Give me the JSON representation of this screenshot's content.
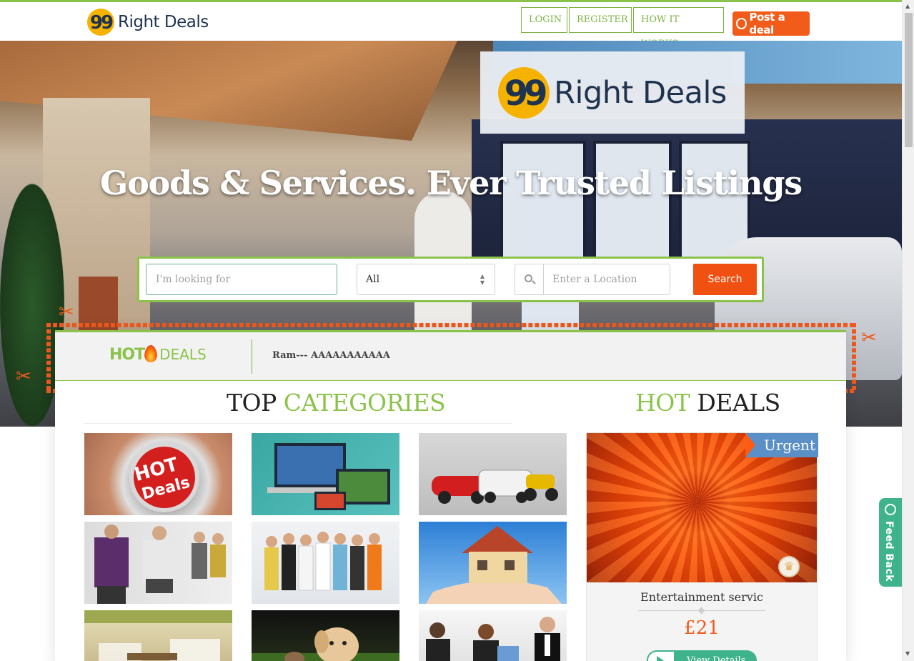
{
  "brand": {
    "name": "Right Deals",
    "mark": "99"
  },
  "nav": {
    "login": "LOGIN",
    "register": "REGISTER",
    "how_it_works": "HOW IT WORKS",
    "post_deal": "Post a deal"
  },
  "hero": {
    "headline": "Goods & Services. Ever Trusted Listings"
  },
  "search": {
    "keyword_placeholder": "I'm looking for",
    "category_selected": "All",
    "location_placeholder": "Enter a Location",
    "button_label": "Search"
  },
  "ticker": {
    "logo_hot": "HOT",
    "logo_deals": "DEALS",
    "text": "Ram--- AAAAAAAAAAA"
  },
  "top_categories": {
    "title_dark": "TOP",
    "title_green": "CATEGORIES",
    "items": [
      {
        "icon": "hot-deals-stopwatch"
      },
      {
        "icon": "electronics-devices"
      },
      {
        "icon": "vehicles"
      },
      {
        "icon": "fashion"
      },
      {
        "icon": "jobs-services"
      },
      {
        "icon": "real-estate"
      },
      {
        "icon": "home-kitchen"
      },
      {
        "icon": "pets"
      },
      {
        "icon": "business-meeting"
      }
    ]
  },
  "hot_deals": {
    "title_green": "HOT",
    "title_dark": "DEALS",
    "card": {
      "badge": "Urgent",
      "name": "Entertainment servic",
      "price": "£21",
      "button": "View Details"
    }
  },
  "feedback": {
    "label": "Feed Back"
  },
  "colors": {
    "accent_green": "#8bc34a",
    "accent_orange": "#f05012",
    "teal": "#3fb38b",
    "brand_navy": "#1e3350",
    "brand_yellow": "#f5b300"
  }
}
